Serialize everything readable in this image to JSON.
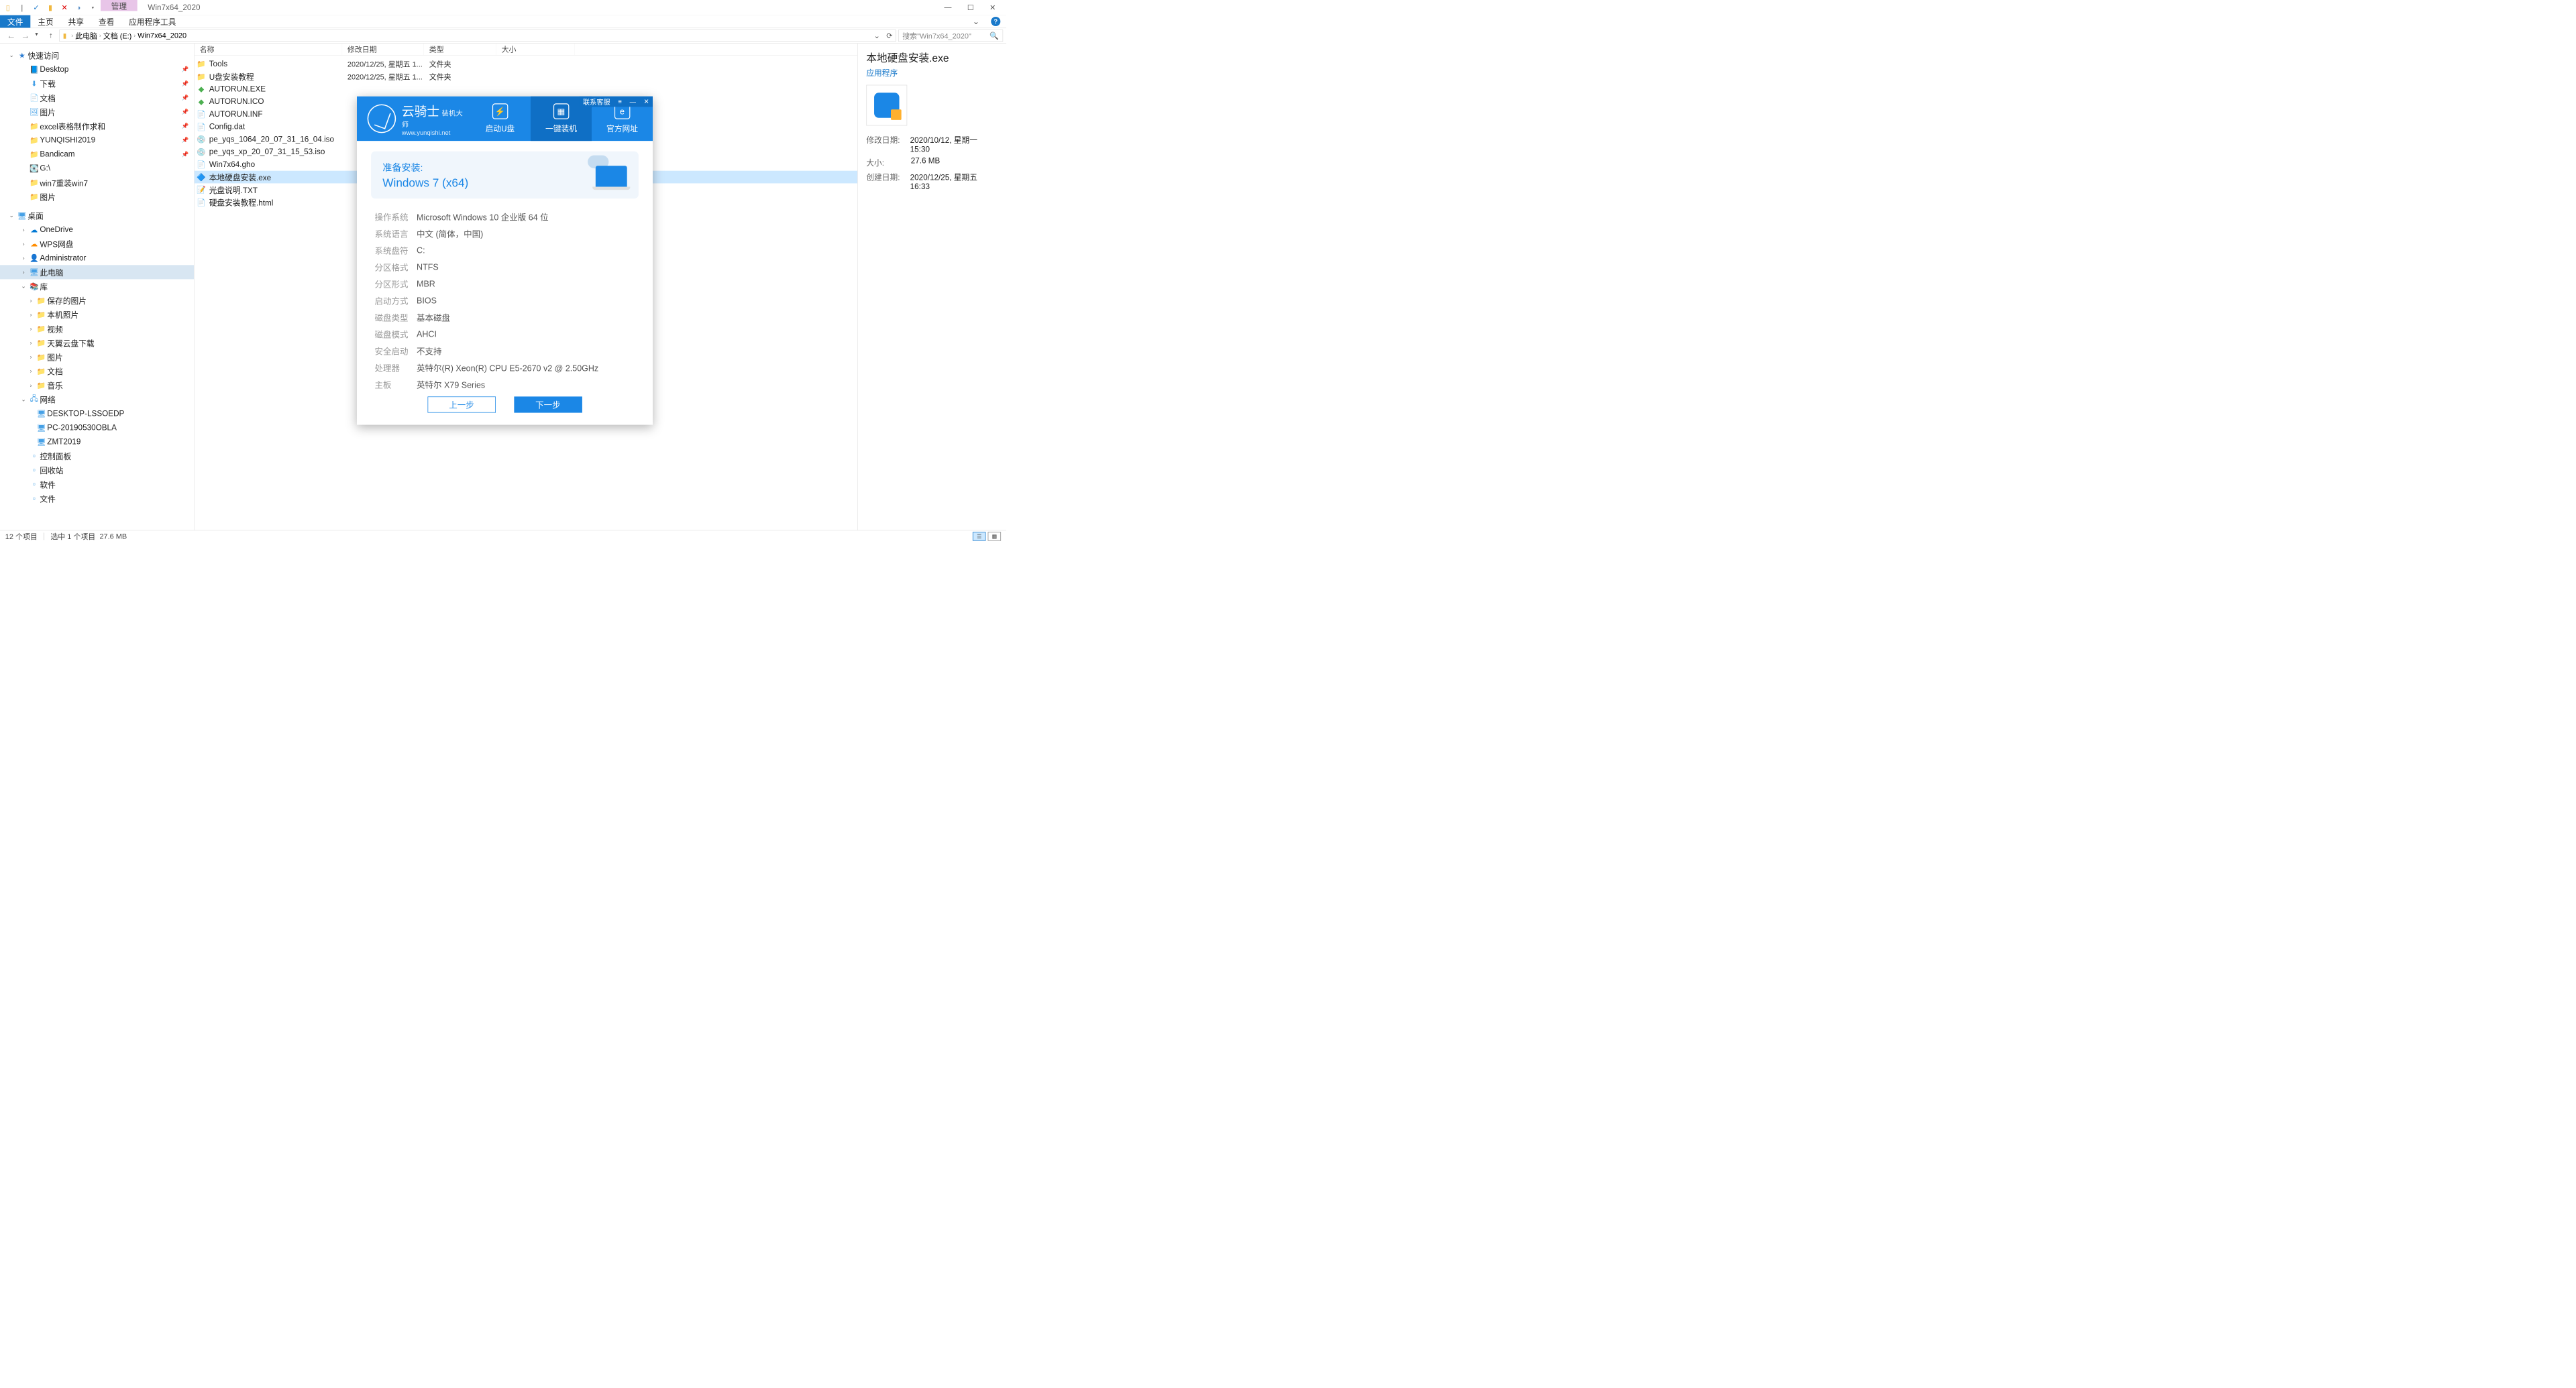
{
  "titlebar": {
    "context_tab": "管理",
    "title": "Win7x64_2020"
  },
  "ribbon": {
    "file": "文件",
    "tabs": [
      "主页",
      "共享",
      "查看",
      "应用程序工具"
    ]
  },
  "breadcrumb": [
    "此电脑",
    "文档 (E:)",
    "Win7x64_2020"
  ],
  "search_placeholder": "搜索\"Win7x64_2020\"",
  "sidebar": {
    "quick_access": "快速访问",
    "quick_items": [
      {
        "label": "Desktop",
        "icon": "📘",
        "pinned": true
      },
      {
        "label": "下载",
        "icon": "⬇",
        "pinned": true
      },
      {
        "label": "文档",
        "icon": "📄",
        "pinned": true
      },
      {
        "label": "图片",
        "icon": "🖼",
        "pinned": true
      },
      {
        "label": "excel表格制作求和",
        "icon": "📁",
        "pinned": true
      },
      {
        "label": "YUNQISHI2019",
        "icon": "📁",
        "pinned": true
      },
      {
        "label": "Bandicam",
        "icon": "📁",
        "pinned": true
      },
      {
        "label": "G:\\",
        "icon": "💽",
        "pinned": false
      },
      {
        "label": "win7重装win7",
        "icon": "📁",
        "pinned": false
      },
      {
        "label": "图片",
        "icon": "📁",
        "pinned": false
      }
    ],
    "desktop": "桌面",
    "desktop_items": [
      {
        "label": "OneDrive",
        "icon": "☁",
        "cls": "ic-cloud"
      },
      {
        "label": "WPS网盘",
        "icon": "☁",
        "cls": "ic-wps"
      },
      {
        "label": "Administrator",
        "icon": "👤",
        "cls": "ic-user"
      },
      {
        "label": "此电脑",
        "icon": "🖥",
        "cls": "ic-pc",
        "selected": true
      },
      {
        "label": "库",
        "icon": "📚",
        "cls": "ic-lib",
        "expanded": true
      }
    ],
    "libraries": [
      "保存的图片",
      "本机照片",
      "视频",
      "天翼云盘下载",
      "图片",
      "文档",
      "音乐"
    ],
    "network": "网络",
    "network_items": [
      "DESKTOP-LSSOEDP",
      "PC-20190530OBLA",
      "ZMT2019"
    ],
    "others": [
      "控制面板",
      "回收站",
      "软件",
      "文件"
    ]
  },
  "columns": {
    "name": "名称",
    "date": "修改日期",
    "type": "类型",
    "size": "大小"
  },
  "files": [
    {
      "name": "Tools",
      "date": "2020/12/25, 星期五 1...",
      "type": "文件夹",
      "icon": "📁",
      "cls": "ic-folder"
    },
    {
      "name": "U盘安装教程",
      "date": "2020/12/25, 星期五 1...",
      "type": "文件夹",
      "icon": "📁",
      "cls": "ic-folder"
    },
    {
      "name": "AUTORUN.EXE",
      "date": "",
      "type": "",
      "icon": "◆",
      "cls": "ic-green"
    },
    {
      "name": "AUTORUN.ICO",
      "date": "",
      "type": "",
      "icon": "◆",
      "cls": "ic-green"
    },
    {
      "name": "AUTORUN.INF",
      "date": "",
      "type": "",
      "icon": "📄",
      "cls": "ic-txt"
    },
    {
      "name": "Config.dat",
      "date": "",
      "type": "",
      "icon": "📄",
      "cls": "ic-txt"
    },
    {
      "name": "pe_yqs_1064_20_07_31_16_04.iso",
      "date": "",
      "type": "",
      "icon": "💿",
      "cls": "ic-disk"
    },
    {
      "name": "pe_yqs_xp_20_07_31_15_53.iso",
      "date": "",
      "type": "",
      "icon": "💿",
      "cls": "ic-disk"
    },
    {
      "name": "Win7x64.gho",
      "date": "",
      "type": "",
      "icon": "📄",
      "cls": "ic-txt"
    },
    {
      "name": "本地硬盘安装.exe",
      "date": "",
      "type": "",
      "icon": "🔷",
      "cls": "ic-exe",
      "selected": true
    },
    {
      "name": "光盘说明.TXT",
      "date": "",
      "type": "",
      "icon": "📝",
      "cls": "ic-txt"
    },
    {
      "name": "硬盘安装教程.html",
      "date": "",
      "type": "",
      "icon": "📄",
      "cls": "ic-txt"
    }
  ],
  "details": {
    "title": "本地硬盘安装.exe",
    "type": "应用程序",
    "rows": [
      {
        "label": "修改日期:",
        "value": "2020/10/12, 星期一 15:30"
      },
      {
        "label": "大小:",
        "value": "27.6 MB"
      },
      {
        "label": "创建日期:",
        "value": "2020/12/25, 星期五 16:33"
      }
    ]
  },
  "statusbar": {
    "count": "12 个项目",
    "selected": "选中 1 个项目",
    "size": "27.6 MB"
  },
  "installer": {
    "brand_name": "云骑士",
    "brand_sub": "装机大师",
    "brand_url": "www.yunqishi.net",
    "winbar_text": "联系客服",
    "tabs": [
      {
        "label": "启动U盘",
        "icon": "⚡"
      },
      {
        "label": "一键装机",
        "icon": "▦",
        "active": true
      },
      {
        "label": "官方网址",
        "icon": "e"
      }
    ],
    "prep_title": "准备安装:",
    "prep_os": "Windows 7 (x64)",
    "info": [
      {
        "label": "操作系统",
        "value": "Microsoft Windows 10 企业版 64 位"
      },
      {
        "label": "系统语言",
        "value": "中文 (简体，中国)"
      },
      {
        "label": "系统盘符",
        "value": "C:"
      },
      {
        "label": "分区格式",
        "value": "NTFS"
      },
      {
        "label": "分区形式",
        "value": "MBR"
      },
      {
        "label": "启动方式",
        "value": "BIOS"
      },
      {
        "label": "磁盘类型",
        "value": "基本磁盘"
      },
      {
        "label": "磁盘模式",
        "value": "AHCI"
      },
      {
        "label": "安全启动",
        "value": "不支持"
      },
      {
        "label": "处理器",
        "value": "英特尔(R) Xeon(R) CPU E5-2670 v2 @ 2.50GHz"
      },
      {
        "label": "主板",
        "value": "英特尔 X79 Series"
      }
    ],
    "btn_prev": "上一步",
    "btn_next": "下一步"
  }
}
